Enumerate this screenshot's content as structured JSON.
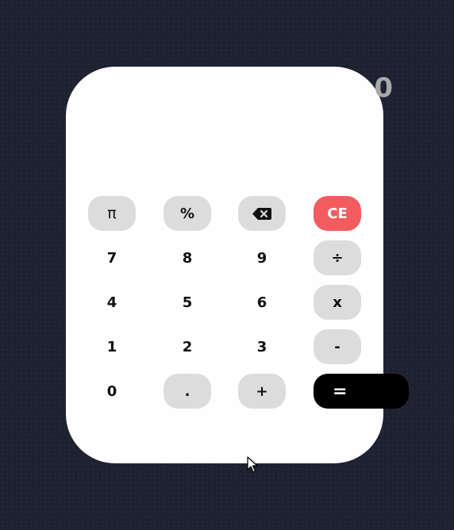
{
  "display": {
    "value": "0"
  },
  "keys": {
    "pi": "π",
    "percent": "%",
    "clear": "CE",
    "seven": "7",
    "eight": "8",
    "nine": "9",
    "divide": "÷",
    "four": "4",
    "five": "5",
    "six": "6",
    "multiply": "x",
    "one": "1",
    "two": "2",
    "three": "3",
    "subtract": "-",
    "zero": "0",
    "decimal": ".",
    "add": "+",
    "equals": "="
  },
  "icons": {
    "backspace": "backspace-icon",
    "cursor": "mouse-pointer-icon"
  },
  "colors": {
    "background": "#1d2130",
    "panel": "#fefefe",
    "key_grey": "#dcdcdc",
    "clear_red": "#f25c5f",
    "equals_black": "#000000",
    "display_text": "#a8a8a8"
  }
}
